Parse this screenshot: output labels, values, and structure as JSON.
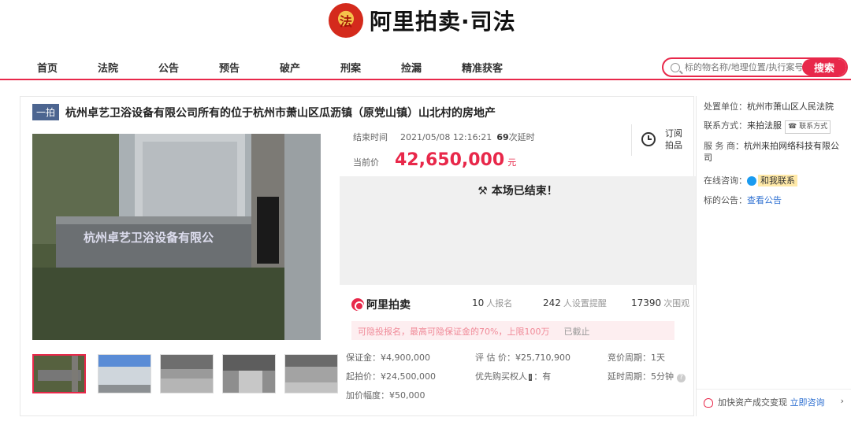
{
  "brand": {
    "emblem_char": "法",
    "name": "阿里拍卖·司法"
  },
  "nav": {
    "items": [
      {
        "label": "首页"
      },
      {
        "label": "法院"
      },
      {
        "label": "公告"
      },
      {
        "label": "预告"
      },
      {
        "label": "破产"
      },
      {
        "label": "刑案"
      },
      {
        "label": "捡漏"
      },
      {
        "label": "精准获客"
      }
    ],
    "search_placeholder": "标的物名称/地理位置/执行案号",
    "search_button": "搜索",
    "accent_color": "#e8284a"
  },
  "lot": {
    "tag": "一拍",
    "title": "杭州卓艺卫浴设备有限公司所有的位于杭州市萧山区瓜沥镇（原党山镇）山北村的房地产",
    "end_label": "结束时间",
    "end_time": "2021/05/08 12:16:21",
    "delay_count": "69",
    "delay_text": "次延时",
    "price_label": "当前价",
    "price": "42,650,000",
    "price_unit": "元",
    "subscribe": "订阅拍品",
    "ended_text": "本场已结束！",
    "platform": "阿里拍卖",
    "stats": [
      {
        "value": "10",
        "unit": "人报名"
      },
      {
        "value": "242",
        "unit": "人设置提醒"
      },
      {
        "value": "17390",
        "unit": "次围观"
      }
    ],
    "notice": "可隐投报名，最高可隐保证金的70%，上限100万",
    "notice_status": "已截止",
    "details": {
      "deposit": "保证金：¥4,900,000",
      "start_price": "起拍价：¥24,500,000",
      "increment": "加价幅度：¥50,000",
      "appraisal": "评 估 价：¥25,710,900",
      "priority": "优先购买权人",
      "priority_value": "：有",
      "bid_period": "竞价周期：1天",
      "delay_period": "延时周期：5分钟"
    }
  },
  "side": {
    "court_label": "处置单位：",
    "court": "杭州市萧山区人民法院",
    "contact_label": "联系方式：",
    "contact": "来拍法服",
    "contact_badge": "联系方式",
    "service_label": "服 务 商：",
    "service": "杭州来拍网络科技有限公司",
    "consult_label": "在线咨询：",
    "consult": "和我联系",
    "announce_label": "标的公告：",
    "announce": "查看公告",
    "footer": "加快资产成交变现",
    "footer_link": "立即咨询"
  }
}
